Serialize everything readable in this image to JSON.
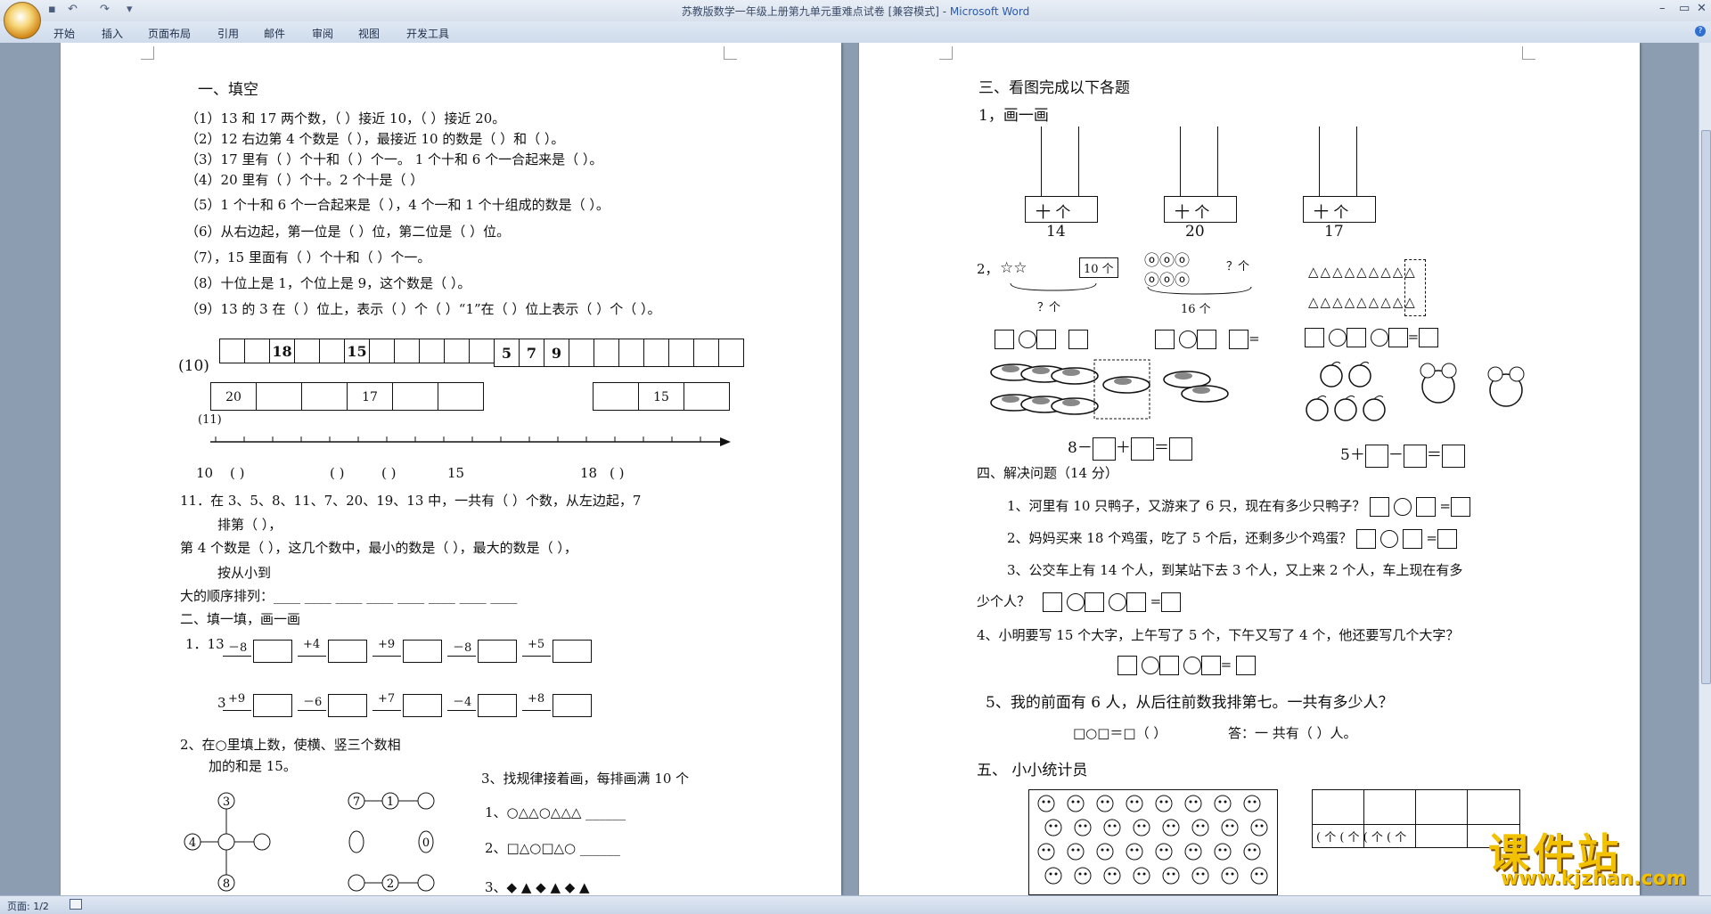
{
  "window": {
    "title_doc": "苏教版数学一年级上册第九单元重难点试卷 [兼容模式] - ",
    "title_app": "Microsoft Word",
    "qa_save": "▪",
    "qa_undo": "↶",
    "qa_redo": "↷",
    "qa_more": "▾",
    "min": "–",
    "max": "▭",
    "close": "✕"
  },
  "ribbon": {
    "tabs": [
      "开始",
      "插入",
      "页面布局",
      "引用",
      "邮件",
      "审阅",
      "视图",
      "开发工具"
    ],
    "help": "?"
  },
  "status": {
    "page": "页面: 1/2"
  },
  "watermark": {
    "brand": "课件站",
    "url": "www.kjzhan.com"
  },
  "page1": {
    "h1": "一、填空",
    "q1": "（1）13 和 17 两个数，（     ）接近 10，（     ）接近 20。",
    "q2": "（2）12 右边第 4 个数是（     ），最接近 10 的数是（     ）和（     ）。",
    "q3": "（3）17 里有（     ）个十和（     ）个一。 1 个十和 6 个一合起来是（     ）。",
    "q4": "（4）20 里有（     ）个十。2 个十是（     ）",
    "q5": "（5）1 个十和 6 个一合起来是（     ），4 个一和 1 个十组成的数是（     ）。",
    "q6": "（6）从右边起，第一位是（     ）位，第二位是（     ）位。",
    "q7": "（7），15 里面有（       ）个十和（       ）个一。",
    "q8": "（8）十位上是 1，个位上是 9，这个数是（     ）。",
    "q9": "（9）13 的 3 在（ ）位上，表示（ ）个（ ）“1”在（ ）位上表示（ ）个（       ）。",
    "q10_label": "(10)",
    "seq1": [
      "",
      "",
      "18",
      "",
      "",
      "15",
      "",
      "",
      "",
      "",
      ""
    ],
    "seq2": [
      "5",
      "7",
      "9",
      "",
      "",
      "",
      "",
      "",
      "",
      ""
    ],
    "row_a": [
      "20",
      "",
      "",
      "17",
      "",
      ""
    ],
    "row_b": [
      "",
      "15",
      ""
    ],
    "q11_label": "(11)",
    "line_labels": {
      "a": "10",
      "b": "15",
      "c": "18"
    },
    "blank_pair": "(      )",
    "q11a": "11．在 3、5、8、11、7、20、19、13 中，一共有（       ）个数，从左边起，7",
    "q11b": "排第（       ），",
    "q11c": "第 4 个数是（       ），这几个数中，最小的数是（       ），最大的数是（       ），",
    "q11d": "按从小到",
    "q11e": "大的顺序排列：____  ____  ____  ____  ____  ____  ____  ____",
    "h2": "二、填一填，画一画",
    "chain1_start": "1．13",
    "chain1_ops": [
      "－8",
      "+4",
      "+9",
      "－8",
      "+5"
    ],
    "chain2_start": "3",
    "chain2_ops": [
      "+9",
      "－6",
      "+7",
      "－4",
      "+8"
    ],
    "h2b1": "2、在○里填上数，使横、竖三个数相",
    "h2b2": "加的和是 15。",
    "h2c": "3、找规律接着画，每排画满 10 个",
    "pat1": "1、○△△○△△△  ______",
    "pat2": "2、□△○□△○   ______",
    "pat3": "3、◆ ▲ ◆ ▲ ◆ ▲",
    "cross1": {
      "top": "3",
      "left": "4",
      "bottom": "8"
    },
    "cross2": {
      "tl": "7",
      "tm": "1",
      "r": "0",
      "bm": "2"
    }
  },
  "page2": {
    "h3": "三、看图完成以下各题",
    "p1": "1，画一画",
    "abacus": [
      {
        "label": "十  个",
        "num": "14"
      },
      {
        "label": "十  个",
        "num": "20"
      },
      {
        "label": "十  个",
        "num": "17"
      }
    ],
    "p2_label": "2，",
    "stars": "☆☆",
    "ten_box": "10 个",
    "q_stars": "？个",
    "apples": "ⓞⓞⓞ",
    "q_apples": "？个",
    "apples_total": "16 个",
    "tri_row": "△△△△△△△△△",
    "eq_ops": {
      "eq": "=",
      "minus8": "8－",
      "plus": "＋",
      "eqs": "＝",
      "five": "5＋",
      "minus": "－"
    },
    "h4": "四、解决问题（14 分）",
    "w1": "1、河里有 10 只鸭子，又游来了 6 只，现在有多少只鸭子？",
    "w2": "2、妈妈买来 18 个鸡蛋，吃了 5 个后，还剩多少个鸡蛋？",
    "w3a": "3、公交车上有 14 个人，到某站下去 3 个人，又上来 2 个人，车上现在有多",
    "w3b": "少个人？",
    "w4": "4、小明要写 15 个大字，上午写了 5 个，下午又写了 4 个，他还要写几个大字？",
    "w5": "5、我的前面有 6 人，从后往前数我排第七。一共有多少人？",
    "w5eq": "□○□＝□（     ）",
    "w5ans": "答：一 共有（     ）人。",
    "h5": "五、 小小统计员",
    "tally": "( 个 (  个  (  个 (  个"
  }
}
